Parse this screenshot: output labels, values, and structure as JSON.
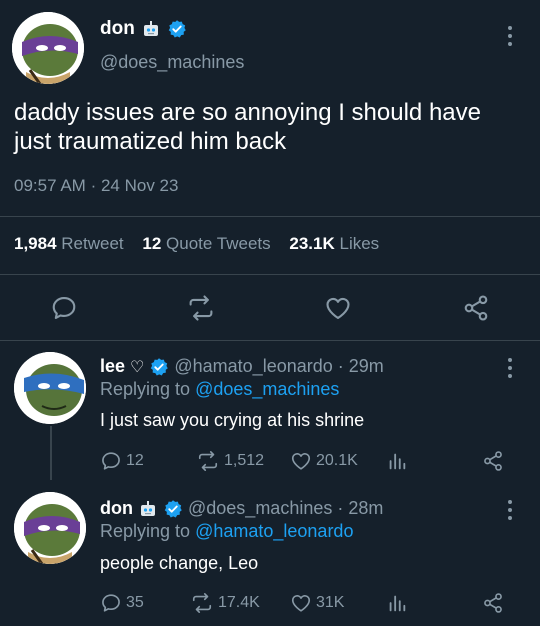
{
  "main_tweet": {
    "display_name": "don",
    "handle": "@does_machines",
    "text": "daddy issues are so annoying I should have just traumatized him back",
    "time": "09:57 AM",
    "sep": "·",
    "date": "24 Nov 23",
    "retweets": "1,984",
    "retweets_label": "Retweet",
    "quotes": "12",
    "quotes_label": "Quote Tweets",
    "likes": "23.1K",
    "likes_label": "Likes"
  },
  "replies": [
    {
      "display_name": "lee",
      "heart_glyph": "♡",
      "handle": "@hamato_leonardo",
      "sep": "·",
      "age": "29m",
      "replying_prefix": "Replying to",
      "replying_to": "@does_machines",
      "text": "I just saw you crying at his shrine",
      "replies": "12",
      "retweets": "1,512",
      "likes": "20.1K"
    },
    {
      "display_name": "don",
      "handle": "@does_machines",
      "sep": "·",
      "age": "28m",
      "replying_prefix": "Replying to",
      "replying_to": "@hamato_leonardo",
      "text": "people change, Leo",
      "replies": "35",
      "retweets": "17.4K",
      "likes": "31K"
    }
  ],
  "colors": {
    "background": "#15202b",
    "muted": "#8899a6",
    "link": "#1da1f2",
    "divider": "#38444d"
  },
  "icons": [
    "robot-icon",
    "verified-icon",
    "more-icon",
    "reply-icon",
    "retweet-icon",
    "like-icon",
    "share-icon",
    "analytics-icon"
  ]
}
